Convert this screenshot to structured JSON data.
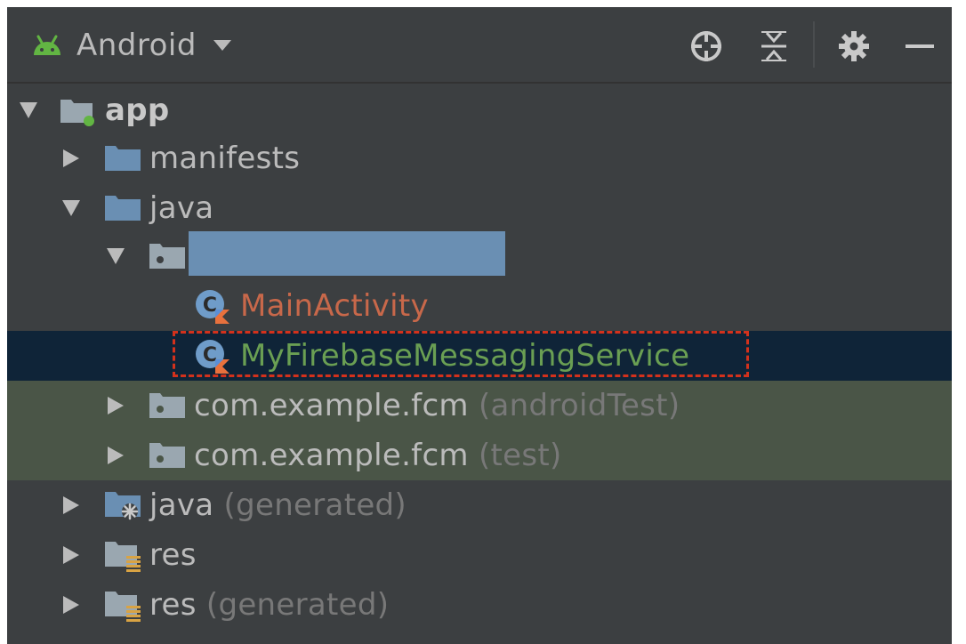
{
  "header": {
    "view_label": "Android",
    "tools": [
      "locate-icon",
      "collapse-all-icon",
      "settings-icon",
      "hide-icon"
    ]
  },
  "tree": {
    "app": "app",
    "manifests": "manifests",
    "java": "java",
    "main_activity": "MainActivity",
    "service": "MyFirebaseMessagingService",
    "android_test_pkg": "com.example.fcm",
    "android_test_suffix": "(androidTest)",
    "test_pkg": "com.example.fcm",
    "test_suffix": "(test)",
    "java_generated": "java",
    "java_generated_suffix": "(generated)",
    "res": "res",
    "res_generated": "res",
    "res_generated_suffix": "(generated)"
  },
  "colors": {
    "panel_bg": "#3c3f41",
    "selected_bg": "#0f2438",
    "group_bg": "#4a5547",
    "folder_blue": "#6a8fb3",
    "highlight_border": "#d3311c",
    "android_green": "#62b543"
  }
}
